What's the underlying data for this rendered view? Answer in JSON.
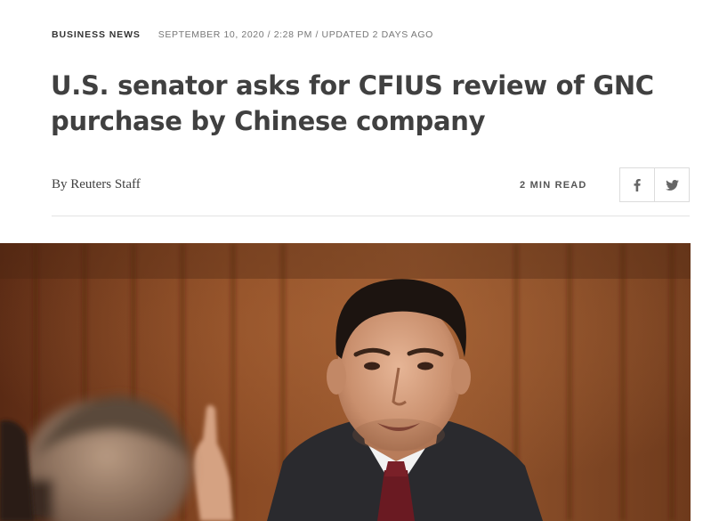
{
  "article": {
    "section": "BUSINESS NEWS",
    "timestamp": "SEPTEMBER 10, 2020 / 2:28 PM / UPDATED 2 DAYS AGO",
    "headline": "U.S. senator asks for CFIUS review of GNC purchase by Chinese company",
    "byline_prefix": "By",
    "byline_author": "Reuters Staff",
    "read_time": "2 MIN READ"
  },
  "share": {
    "facebook_icon": "facebook-icon",
    "twitter_icon": "twitter-icon"
  },
  "hero_image": {
    "subject": "senator-speaking-at-hearing-photo"
  },
  "colors": {
    "headline": "#404040",
    "meta": "#777777",
    "border": "#dcdcdc"
  }
}
